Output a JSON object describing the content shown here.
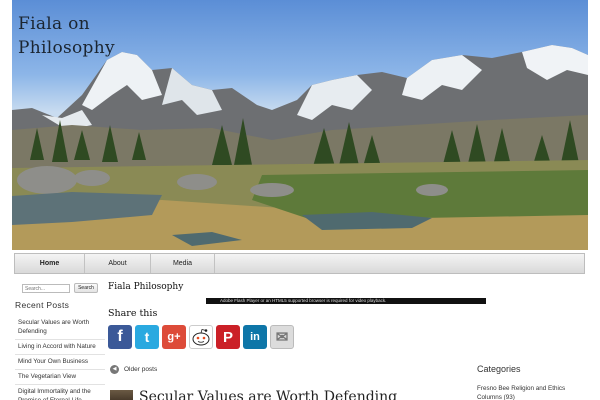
{
  "site": {
    "title": "Fiala on\nPhilosophy"
  },
  "nav": {
    "items": [
      {
        "label": "Home",
        "active": true
      },
      {
        "label": "About"
      },
      {
        "label": "Media"
      }
    ]
  },
  "search": {
    "placeholder": "Search...",
    "button_label": "Search"
  },
  "recent_posts": {
    "heading": "Recent Posts",
    "items": [
      "Secular Values are Worth Defending",
      "Living in Accord with Nature",
      "Mind Your Own Business",
      "The Vegetarian View",
      "Digital Immortality and the Promise of Eternal Life"
    ]
  },
  "main": {
    "heading": "Fiala Philosophy",
    "flash_notice": "Adobe Flash Player or an HTML5 supported browser is required for video playback.",
    "share_heading": "Share this",
    "share_buttons": [
      {
        "name": "facebook",
        "glyph": "f",
        "color": "#3b5998"
      },
      {
        "name": "twitter",
        "glyph": "t",
        "color": "#2aa9e0"
      },
      {
        "name": "google-plus",
        "glyph": "g+",
        "color": "#dd4b39"
      },
      {
        "name": "reddit",
        "glyph": "r",
        "color": "#ffffff"
      },
      {
        "name": "pinterest",
        "glyph": "P",
        "color": "#cb2027"
      },
      {
        "name": "linkedin",
        "glyph": "in",
        "color": "#0e76a8"
      },
      {
        "name": "email",
        "glyph": "✉",
        "color": "#dcdcdc"
      }
    ],
    "older_posts_label": "Older posts",
    "first_post_title": "Secular Values are Worth Defending"
  },
  "categories": {
    "heading": "Categories",
    "first_item": "Fresno Bee Religion and Ethics Columns (93)"
  }
}
